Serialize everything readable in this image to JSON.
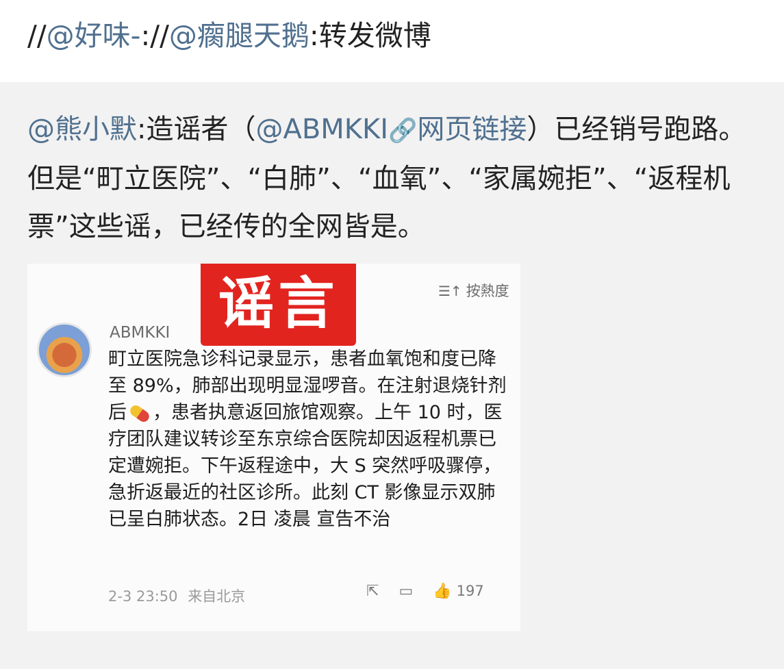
{
  "repost": {
    "prefix": "//",
    "user1": "@好味-",
    "sep": "://",
    "user2": "@瘸腿天鹅",
    "text": ":转发微博"
  },
  "quoted": {
    "author": "@熊小默",
    "text_before": ":造谣者（",
    "account_mention": "@ABMKKI",
    "link_icon": "link-icon",
    "link_text": "网页链接",
    "text_after": "）已经销号跑路。但是“町立医院”、“白肺”、“血氧”、“家属婉拒”、“返程机票”这些谣，已经传的全网皆是。"
  },
  "card": {
    "stamp": "谣言",
    "sort_icon": "sort-icon",
    "sort_label": "按熱度",
    "poster": "ABMKKI",
    "body_part1": "町立医院急诊科记录显示，患者血氧饱和度已降至 89%，肺部出现明显湿啰音。在注射退烧针剂后",
    "pill_icon": "pill-emoji",
    "body_part2": "，患者执意返回旅馆观察。上午 10 时，医疗团队建议转诊至东京综合医院却因返程机票已定遭婉拒。下午返程途中，大 S 突然呼吸骤停，急折返最近的社区诊所。此刻 CT 影像显示双肺已呈白肺状态。2日 凌晨 宣告不治",
    "time": "2-3 23:50",
    "source": "来自北京",
    "share_icon": "share-icon",
    "comment_icon": "comment-icon",
    "like_icon": "thumbs-up-icon",
    "like_count": "197"
  },
  "colors": {
    "mention": "#50708f",
    "stamp_red": "#e2241f",
    "quoted_bg": "#f2f2f2"
  }
}
